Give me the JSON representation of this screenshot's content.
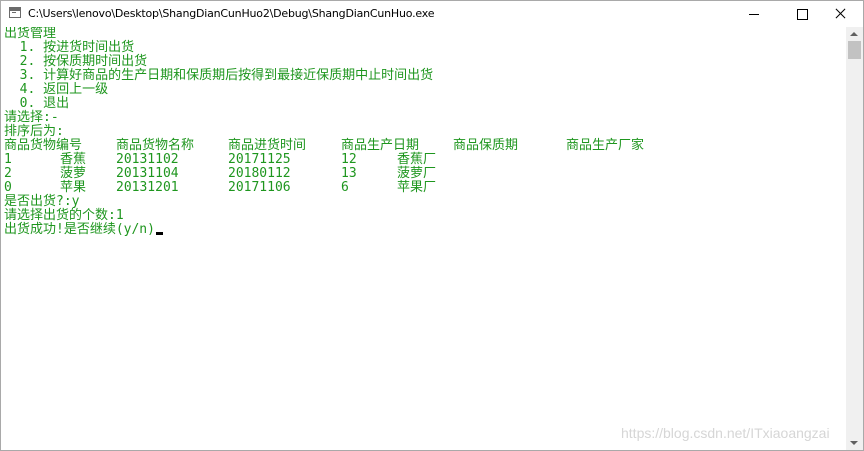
{
  "window": {
    "title": "C:\\Users\\lenovo\\Desktop\\ShangDianCunHuo2\\Debug\\ShangDianCunHuo.exe",
    "controls": [
      "minimize",
      "maximize",
      "close"
    ]
  },
  "console": {
    "menu": [
      "出货管理",
      "  1. 按进货时间出货",
      "  2. 按保质期时间出货",
      "  3. 计算好商品的生产日期和保质期后按得到最接近保质期中止时间出货",
      "  4. 返回上一级",
      "  0. 退出",
      "请选择:-",
      "排序后为:"
    ],
    "table": {
      "headers": [
        "商品货物编号",
        "商品货物名称",
        "商品进货时间",
        "商品生产日期",
        "商品保质期",
        "商品生产厂家"
      ],
      "rows": [
        [
          "1",
          "香蕉",
          "20131102",
          "20171125",
          "12",
          "香蕉厂"
        ],
        [
          "2",
          "菠萝",
          "20131104",
          "20180112",
          "13",
          "菠萝厂"
        ],
        [
          "0",
          "苹果",
          "20131201",
          "20171106",
          "6",
          "苹果厂"
        ]
      ]
    },
    "after": [
      "是否出货?:y",
      "请选择出货的个数:1",
      "出货成功!是否继续(y/n)"
    ]
  },
  "watermark": "https://blog.csdn.net/ITxiaoangzai",
  "colors": {
    "console_text": "#1e961e",
    "console_bg": "#ffffff",
    "cursor": "#000000"
  }
}
